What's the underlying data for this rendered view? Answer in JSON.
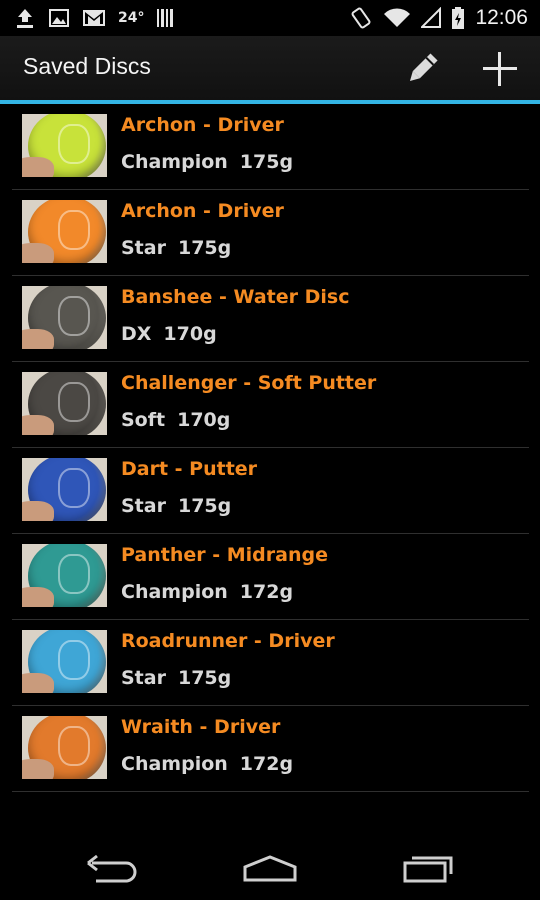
{
  "status_bar": {
    "temperature": "24°",
    "time": "12:06",
    "icons": [
      "upload-icon",
      "image-icon",
      "gmail-icon",
      "barcode-icon",
      "rotate-icon",
      "wifi-icon",
      "signal-icon",
      "battery-icon"
    ]
  },
  "action_bar": {
    "title": "Saved Discs",
    "actions": [
      "pencil-icon",
      "plus-icon"
    ],
    "accent_color": "#33b5e5"
  },
  "discs": [
    {
      "name": "Archon - Driver",
      "plastic": "Champion",
      "weight": "175g",
      "color": "#c8e23a"
    },
    {
      "name": "Archon - Driver",
      "plastic": "Star",
      "weight": "175g",
      "color": "#f2892a"
    },
    {
      "name": "Banshee - Water Disc",
      "plastic": "DX",
      "weight": "170g",
      "color": "#585650"
    },
    {
      "name": "Challenger - Soft Putter",
      "plastic": "Soft",
      "weight": "170g",
      "color": "#4b4844"
    },
    {
      "name": "Dart - Putter",
      "plastic": "Star",
      "weight": "175g",
      "color": "#2f56b8"
    },
    {
      "name": "Panther - Midrange",
      "plastic": "Champion",
      "weight": "172g",
      "color": "#2f9a93"
    },
    {
      "name": "Roadrunner - Driver",
      "plastic": "Star",
      "weight": "175g",
      "color": "#3fa6d6"
    },
    {
      "name": "Wraith - Driver",
      "plastic": "Champion",
      "weight": "172g",
      "color": "#e27a2c"
    }
  ],
  "nav_bar": {
    "buttons": [
      "back-icon",
      "home-icon",
      "recent-apps-icon"
    ]
  },
  "colors": {
    "title_text": "#f58b22",
    "meta_text": "#d8d8d8",
    "divider": "#2f2f2f"
  }
}
